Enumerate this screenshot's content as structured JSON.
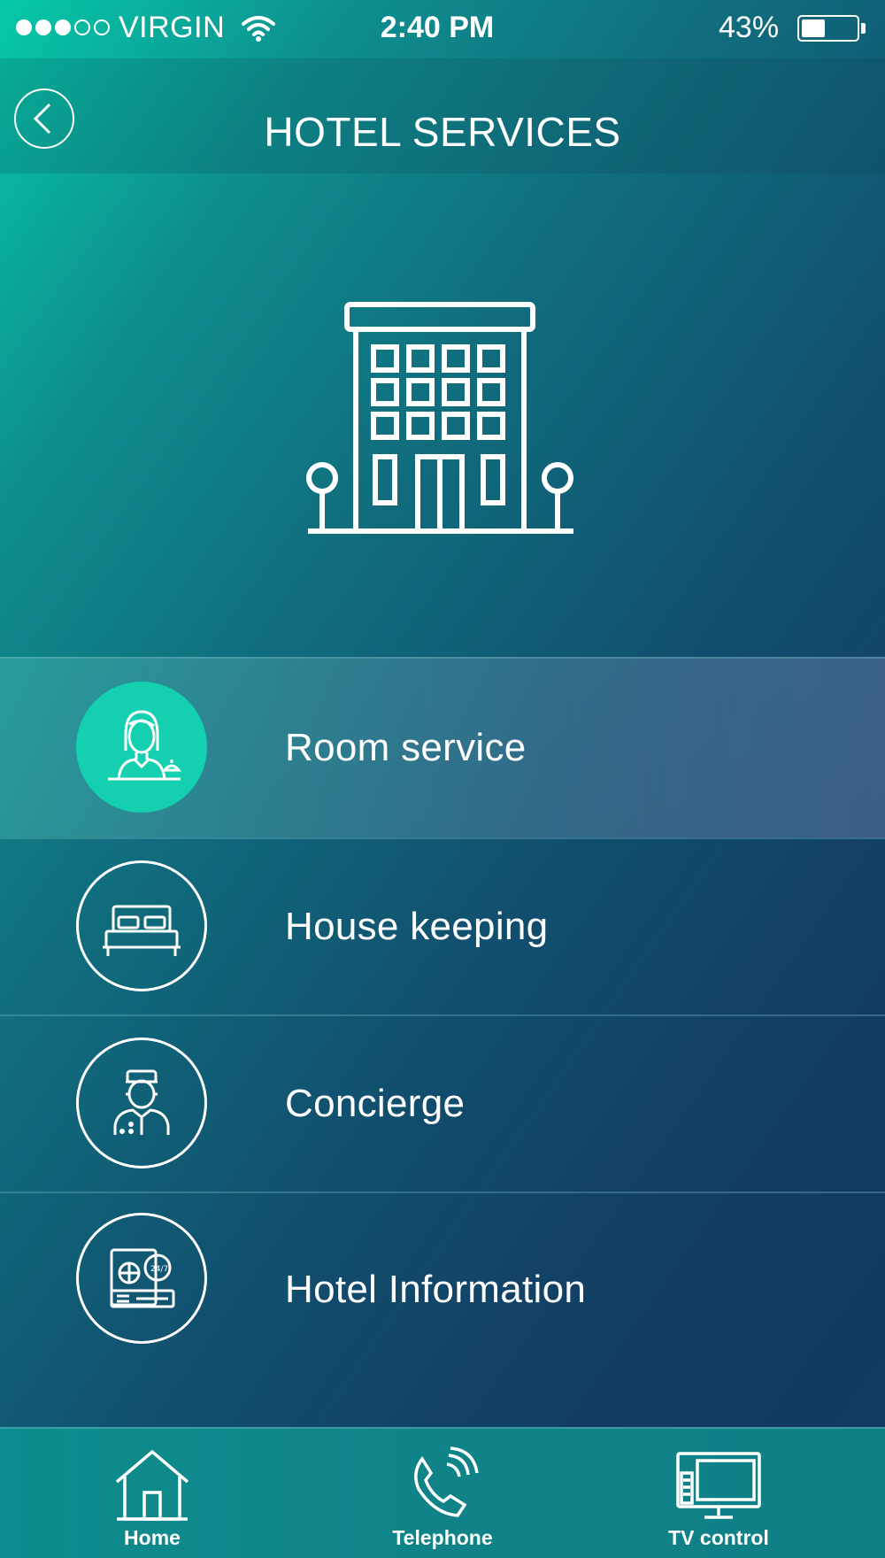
{
  "status_bar": {
    "carrier": "VIRGIN",
    "time": "2:40 PM",
    "battery_percent_text": "43%",
    "battery_level": 0.43,
    "signal_bars_filled": 3,
    "signal_bars_total": 5
  },
  "header": {
    "title": "HOTEL SERVICES",
    "back_icon": "chevron-left-icon"
  },
  "hero": {
    "icon": "hotel-building-icon"
  },
  "services": [
    {
      "label": "Room service",
      "icon": "room-service-attendant-icon",
      "selected": true
    },
    {
      "label": "House keeping",
      "icon": "bed-icon",
      "selected": false
    },
    {
      "label": "Concierge",
      "icon": "concierge-icon",
      "selected": false
    },
    {
      "label": "Hotel Information",
      "icon": "passport-info-icon",
      "selected": false
    }
  ],
  "tab_bar": {
    "tabs": [
      {
        "label": "Home",
        "icon": "home-icon"
      },
      {
        "label": "Telephone",
        "icon": "telephone-icon"
      },
      {
        "label": "TV control",
        "icon": "tv-icon"
      }
    ]
  },
  "colors": {
    "accent": "#14d0b0",
    "gradient_start": "#06c9a8",
    "gradient_end": "#13395f",
    "text": "#ffffff"
  }
}
